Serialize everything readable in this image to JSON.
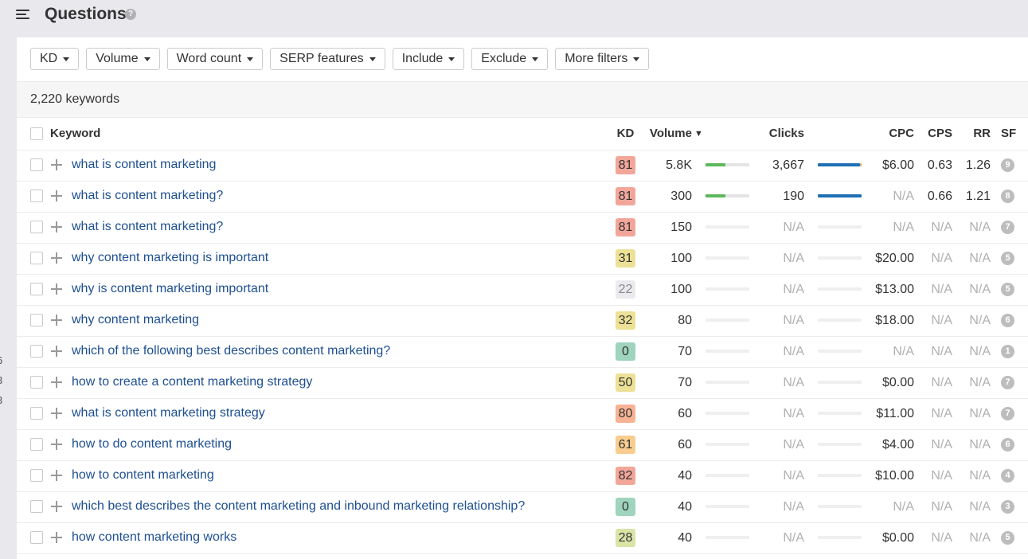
{
  "header": {
    "title": "Questions",
    "help_icon": "?"
  },
  "left_edge_digits": [
    "6",
    "3",
    "3"
  ],
  "filters": [
    {
      "label": "KD"
    },
    {
      "label": "Volume"
    },
    {
      "label": "Word count"
    },
    {
      "label": "SERP features"
    },
    {
      "label": "Include"
    },
    {
      "label": "Exclude"
    },
    {
      "label": "More filters"
    }
  ],
  "summary": {
    "count_text": "2,220 keywords"
  },
  "columns": {
    "keyword": "Keyword",
    "kd": "KD",
    "volume": "Volume",
    "volume_sort": "▼",
    "clicks": "Clicks",
    "cpc": "CPC",
    "cps": "CPS",
    "rr": "RR",
    "sf": "SF"
  },
  "kd_colors": {
    "very_hard": "#f2a69a",
    "hard": "#f7b394",
    "medium_hard": "#f8cd8f",
    "medium": "#ece196",
    "easy_medium": "#d9e4a6",
    "easy": "#9fd4bf",
    "unknown": "#ebebef"
  },
  "bar_colors": {
    "volume": "#5cb85c",
    "clicks_organic": "#1f6fb4",
    "clicks_paid": "#e8a35a"
  },
  "rows": [
    {
      "keyword": "what is content marketing",
      "kd": "81",
      "kd_level": "very_hard",
      "volume": "5.8K",
      "volume_bar": 0.45,
      "clicks": "3,667",
      "clicks_bar": 0.97,
      "clicks_paid": 0.03,
      "cpc": "$6.00",
      "cps": "0.63",
      "rr": "1.26",
      "sf": "9"
    },
    {
      "keyword": "what is content marketing?",
      "kd": "81",
      "kd_level": "very_hard",
      "volume": "300",
      "volume_bar": 0.45,
      "clicks": "190",
      "clicks_bar": 1.0,
      "clicks_paid": 0,
      "cpc": "N/A",
      "cps": "0.66",
      "rr": "1.21",
      "sf": "8"
    },
    {
      "keyword": "what is content marketing?",
      "kd": "81",
      "kd_level": "very_hard",
      "volume": "150",
      "volume_bar": 0,
      "clicks": "N/A",
      "clicks_bar": 0,
      "clicks_paid": 0,
      "cpc": "N/A",
      "cps": "N/A",
      "rr": "N/A",
      "sf": "7"
    },
    {
      "keyword": "why content marketing is important",
      "kd": "31",
      "kd_level": "medium",
      "volume": "100",
      "volume_bar": 0,
      "clicks": "N/A",
      "clicks_bar": 0,
      "clicks_paid": 0,
      "cpc": "$20.00",
      "cps": "N/A",
      "rr": "N/A",
      "sf": "5"
    },
    {
      "keyword": "why is content marketing important",
      "kd": "22",
      "kd_level": "unknown",
      "volume": "100",
      "volume_bar": 0,
      "clicks": "N/A",
      "clicks_bar": 0,
      "clicks_paid": 0,
      "cpc": "$13.00",
      "cps": "N/A",
      "rr": "N/A",
      "sf": "5"
    },
    {
      "keyword": "why content marketing",
      "kd": "32",
      "kd_level": "medium",
      "volume": "80",
      "volume_bar": 0,
      "clicks": "N/A",
      "clicks_bar": 0,
      "clicks_paid": 0,
      "cpc": "$18.00",
      "cps": "N/A",
      "rr": "N/A",
      "sf": "6"
    },
    {
      "keyword": "which of the following best describes content marketing?",
      "kd": "0",
      "kd_level": "easy",
      "volume": "70",
      "volume_bar": 0,
      "clicks": "N/A",
      "clicks_bar": 0,
      "clicks_paid": 0,
      "cpc": "N/A",
      "cps": "N/A",
      "rr": "N/A",
      "sf": "1"
    },
    {
      "keyword": "how to create a content marketing strategy",
      "kd": "50",
      "kd_level": "medium",
      "volume": "70",
      "volume_bar": 0,
      "clicks": "N/A",
      "clicks_bar": 0,
      "clicks_paid": 0,
      "cpc": "$0.00",
      "cps": "N/A",
      "rr": "N/A",
      "sf": "7"
    },
    {
      "keyword": "what is content marketing strategy",
      "kd": "80",
      "kd_level": "hard",
      "volume": "60",
      "volume_bar": 0,
      "clicks": "N/A",
      "clicks_bar": 0,
      "clicks_paid": 0,
      "cpc": "$11.00",
      "cps": "N/A",
      "rr": "N/A",
      "sf": "7"
    },
    {
      "keyword": "how to do content marketing",
      "kd": "61",
      "kd_level": "medium_hard",
      "volume": "60",
      "volume_bar": 0,
      "clicks": "N/A",
      "clicks_bar": 0,
      "clicks_paid": 0,
      "cpc": "$4.00",
      "cps": "N/A",
      "rr": "N/A",
      "sf": "6"
    },
    {
      "keyword": "how to content marketing",
      "kd": "82",
      "kd_level": "very_hard",
      "volume": "40",
      "volume_bar": 0,
      "clicks": "N/A",
      "clicks_bar": 0,
      "clicks_paid": 0,
      "cpc": "$10.00",
      "cps": "N/A",
      "rr": "N/A",
      "sf": "4"
    },
    {
      "keyword": "which best describes the content marketing and inbound marketing relationship?",
      "kd": "0",
      "kd_level": "easy",
      "volume": "40",
      "volume_bar": 0,
      "clicks": "N/A",
      "clicks_bar": 0,
      "clicks_paid": 0,
      "cpc": "N/A",
      "cps": "N/A",
      "rr": "N/A",
      "sf": "3"
    },
    {
      "keyword": "how content marketing works",
      "kd": "28",
      "kd_level": "easy_medium",
      "volume": "40",
      "volume_bar": 0,
      "clicks": "N/A",
      "clicks_bar": 0,
      "clicks_paid": 0,
      "cpc": "$0.00",
      "cps": "N/A",
      "rr": "N/A",
      "sf": "5"
    }
  ]
}
